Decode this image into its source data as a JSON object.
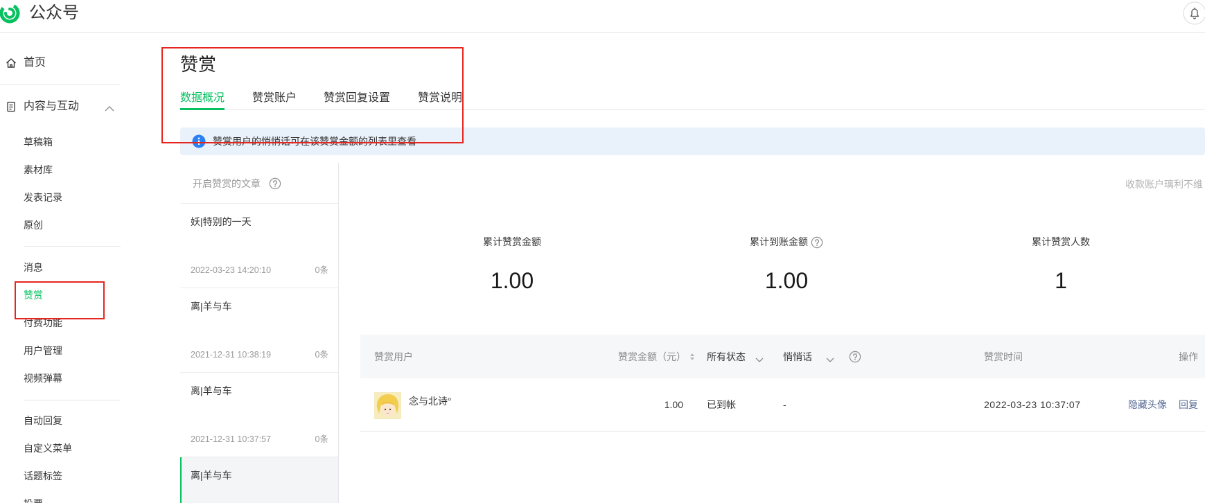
{
  "header": {
    "app_title": "公众号",
    "logo_icon": "wechat-official-account-logo-icon",
    "notification_icon": "bell-icon"
  },
  "colors": {
    "accent": "#07c160",
    "link": "#576b95",
    "text": "#353535",
    "muted": "#9a9a9a",
    "info_background": "#e9f1fb",
    "info_icon": "#2b81f2",
    "annotation": "#e5261e"
  },
  "sidebar": {
    "home": {
      "label": "首页",
      "icon": "home-icon"
    },
    "content_section": {
      "label": "内容与互动",
      "icon": "document-icon",
      "toggle_icon": "chevron-up-icon",
      "expanded": true
    },
    "content_items": [
      {
        "label": "草稿箱"
      },
      {
        "label": "素材库"
      },
      {
        "label": "发表记录"
      },
      {
        "label": "原创"
      }
    ],
    "interaction_items": [
      {
        "label": "消息"
      },
      {
        "label": "赞赏",
        "selected": true
      },
      {
        "label": "付费功能"
      },
      {
        "label": "用户管理"
      },
      {
        "label": "视频弹幕"
      }
    ],
    "tool_items": [
      {
        "label": "自动回复"
      },
      {
        "label": "自定义菜单"
      },
      {
        "label": "话题标签"
      },
      {
        "label": "投票"
      }
    ]
  },
  "page": {
    "title": "赞赏",
    "tabs": [
      {
        "label": "数据概况",
        "selected": true
      },
      {
        "label": "赞赏账户"
      },
      {
        "label": "赞赏回复设置"
      },
      {
        "label": "赞赏说明"
      }
    ]
  },
  "notice": {
    "icon": "info-icon",
    "text": "赞赏用户的悄悄话可在该赞赏金额的列表里查看"
  },
  "article_list": {
    "header": "开启赞赏的文章",
    "help_icon": "question-circle-icon",
    "items": [
      {
        "title": "妖|特别的一天",
        "time": "2022-03-23 14:20:10",
        "count": "0条"
      },
      {
        "title": "离|羊与车",
        "time": "2021-12-31 10:38:19",
        "count": "0条"
      },
      {
        "title": "离|羊与车",
        "time": "2021-12-31 10:37:57",
        "count": "0条"
      },
      {
        "title": "离|羊与车",
        "selected": true
      }
    ]
  },
  "account_note": "收款账户璃利不维",
  "stats": [
    {
      "label": "累计赞赏金额",
      "value": "1.00"
    },
    {
      "label": "累计到账金额",
      "value": "1.00",
      "help_icon": "question-circle-icon"
    },
    {
      "label": "累计赞赏人数",
      "value": "1"
    }
  ],
  "table": {
    "columns": {
      "user": "赞赏用户",
      "amount": "赞赏金额（元）",
      "status": "所有状态",
      "message": "悄悄话",
      "time": "赞赏时间",
      "actions": "操作"
    },
    "sort_icon": "sort-icon",
    "filter_icon": "chevron-down-icon",
    "help_icon": "question-circle-icon",
    "rows": [
      {
        "avatar": "user-avatar-image",
        "user": "念与北诗°",
        "amount": "1.00",
        "status": "已到帐",
        "message": "-",
        "time": "2022-03-23 10:37:07",
        "actions": [
          "隐藏头像",
          "回复"
        ]
      }
    ]
  }
}
